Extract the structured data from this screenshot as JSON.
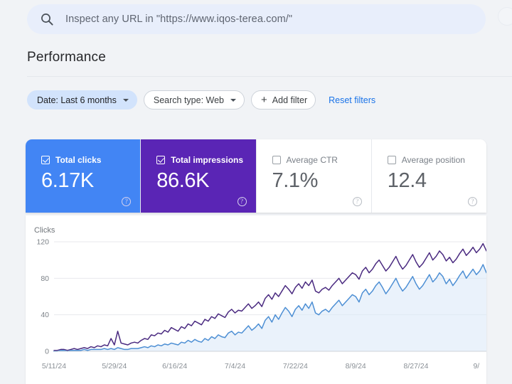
{
  "search": {
    "placeholder": "Inspect any URL in \"https://www.iqos-terea.com/\"",
    "icon": "search-icon"
  },
  "header": {
    "title": "Performance"
  },
  "filters": {
    "date_chip": "Date: Last 6 months",
    "search_type_chip": "Search type: Web",
    "add_filter": "Add filter",
    "add_filter_icon": "plus-icon",
    "reset": "Reset filters"
  },
  "metric_cards": [
    {
      "label": "Total clicks",
      "value": "6.17K",
      "checked": true,
      "selected": true,
      "color": "#4285f4",
      "help_icon": "help-icon"
    },
    {
      "label": "Total impressions",
      "value": "86.6K",
      "checked": true,
      "selected": true,
      "color": "#5a25b5",
      "help_icon": "help-icon"
    },
    {
      "label": "Average CTR",
      "value": "7.1%",
      "checked": false,
      "selected": false,
      "color": "#ffffff",
      "help_icon": "help-icon"
    },
    {
      "label": "Average position",
      "value": "12.4",
      "checked": false,
      "selected": false,
      "color": "#ffffff",
      "help_icon": "help-icon"
    }
  ],
  "chart_data": {
    "type": "line",
    "title": "",
    "ylabel": "Clicks",
    "xlabel": "",
    "ylim": [
      0,
      120
    ],
    "yticks": [
      0,
      40,
      80,
      120
    ],
    "grid": true,
    "legend": "none",
    "xtick_labels": [
      "5/11/24",
      "5/29/24",
      "6/16/24",
      "7/4/24",
      "7/22/24",
      "8/9/24",
      "8/27/24",
      "9/"
    ],
    "xtick_positions": [
      0,
      18,
      36,
      54,
      72,
      90,
      108,
      126
    ],
    "series": [
      {
        "name": "Total impressions",
        "color": "#4a2a80",
        "values": [
          1,
          1,
          2,
          2,
          1,
          2,
          3,
          2,
          3,
          4,
          3,
          5,
          4,
          6,
          5,
          7,
          6,
          14,
          7,
          22,
          9,
          8,
          7,
          9,
          10,
          9,
          12,
          14,
          13,
          18,
          17,
          20,
          19,
          23,
          21,
          26,
          24,
          22,
          27,
          25,
          30,
          28,
          33,
          31,
          29,
          35,
          33,
          38,
          36,
          41,
          39,
          37,
          43,
          46,
          42,
          45,
          44,
          48,
          52,
          47,
          50,
          54,
          49,
          58,
          62,
          57,
          64,
          60,
          66,
          72,
          68,
          63,
          70,
          74,
          69,
          76,
          72,
          78,
          66,
          64,
          68,
          70,
          67,
          72,
          76,
          80,
          74,
          78,
          82,
          86,
          84,
          79,
          88,
          92,
          86,
          90,
          96,
          100,
          94,
          88,
          92,
          98,
          104,
          96,
          90,
          94,
          100,
          106,
          98,
          92,
          96,
          102,
          108,
          100,
          104,
          110,
          106,
          99,
          103,
          97,
          101,
          107,
          112,
          105,
          109,
          114,
          108,
          112,
          118,
          110
        ]
      },
      {
        "name": "Total clicks",
        "color": "#4d8fd4",
        "values": [
          0,
          0,
          1,
          1,
          0,
          1,
          1,
          1,
          1,
          2,
          1,
          2,
          2,
          2,
          2,
          3,
          2,
          3,
          2,
          4,
          3,
          2,
          2,
          3,
          3,
          3,
          4,
          5,
          4,
          6,
          5,
          7,
          6,
          8,
          7,
          9,
          8,
          7,
          10,
          9,
          12,
          10,
          13,
          11,
          10,
          14,
          12,
          16,
          14,
          18,
          16,
          15,
          20,
          22,
          18,
          21,
          20,
          24,
          28,
          23,
          26,
          30,
          25,
          34,
          38,
          32,
          40,
          35,
          42,
          48,
          44,
          38,
          46,
          50,
          45,
          52,
          47,
          54,
          42,
          40,
          44,
          46,
          43,
          48,
          52,
          56,
          50,
          54,
          58,
          62,
          60,
          54,
          64,
          68,
          62,
          66,
          72,
          76,
          70,
          63,
          68,
          74,
          80,
          72,
          66,
          70,
          76,
          82,
          74,
          68,
          72,
          78,
          84,
          76,
          80,
          86,
          82,
          74,
          79,
          72,
          77,
          83,
          88,
          80,
          85,
          90,
          84,
          88,
          95,
          86
        ]
      }
    ]
  }
}
